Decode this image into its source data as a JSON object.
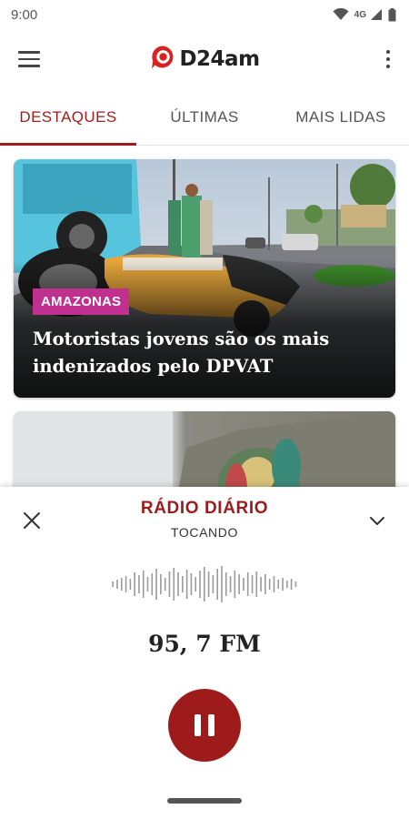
{
  "status_bar": {
    "time": "9:00",
    "network_label": "4G",
    "icons": [
      "wifi-icon",
      "cellular-signal-icon",
      "battery-icon"
    ]
  },
  "app_bar": {
    "logo_text": "D24am",
    "icons": [
      "hamburger-menu-icon",
      "logo-mark-icon",
      "more-vert-icon"
    ],
    "brand_color": "#9e1b1b"
  },
  "tabs": [
    {
      "label": "DESTAQUES",
      "active": true
    },
    {
      "label": "ÚLTIMAS",
      "active": false
    },
    {
      "label": "MAIS LIDAS",
      "active": false
    }
  ],
  "articles": [
    {
      "category": "AMAZONAS",
      "category_color": "#c0308f",
      "headline": "Motoristas jovens são os mais indenizados pelo DPVAT"
    },
    {
      "category": "",
      "headline": ""
    }
  ],
  "player": {
    "station_name": "RÁDIO DIÁRIO",
    "status": "TOCANDO",
    "frequency": "95, 7 FM",
    "icons": [
      "close-icon",
      "chevron-down-icon",
      "waveform-icon",
      "pause-icon"
    ]
  }
}
